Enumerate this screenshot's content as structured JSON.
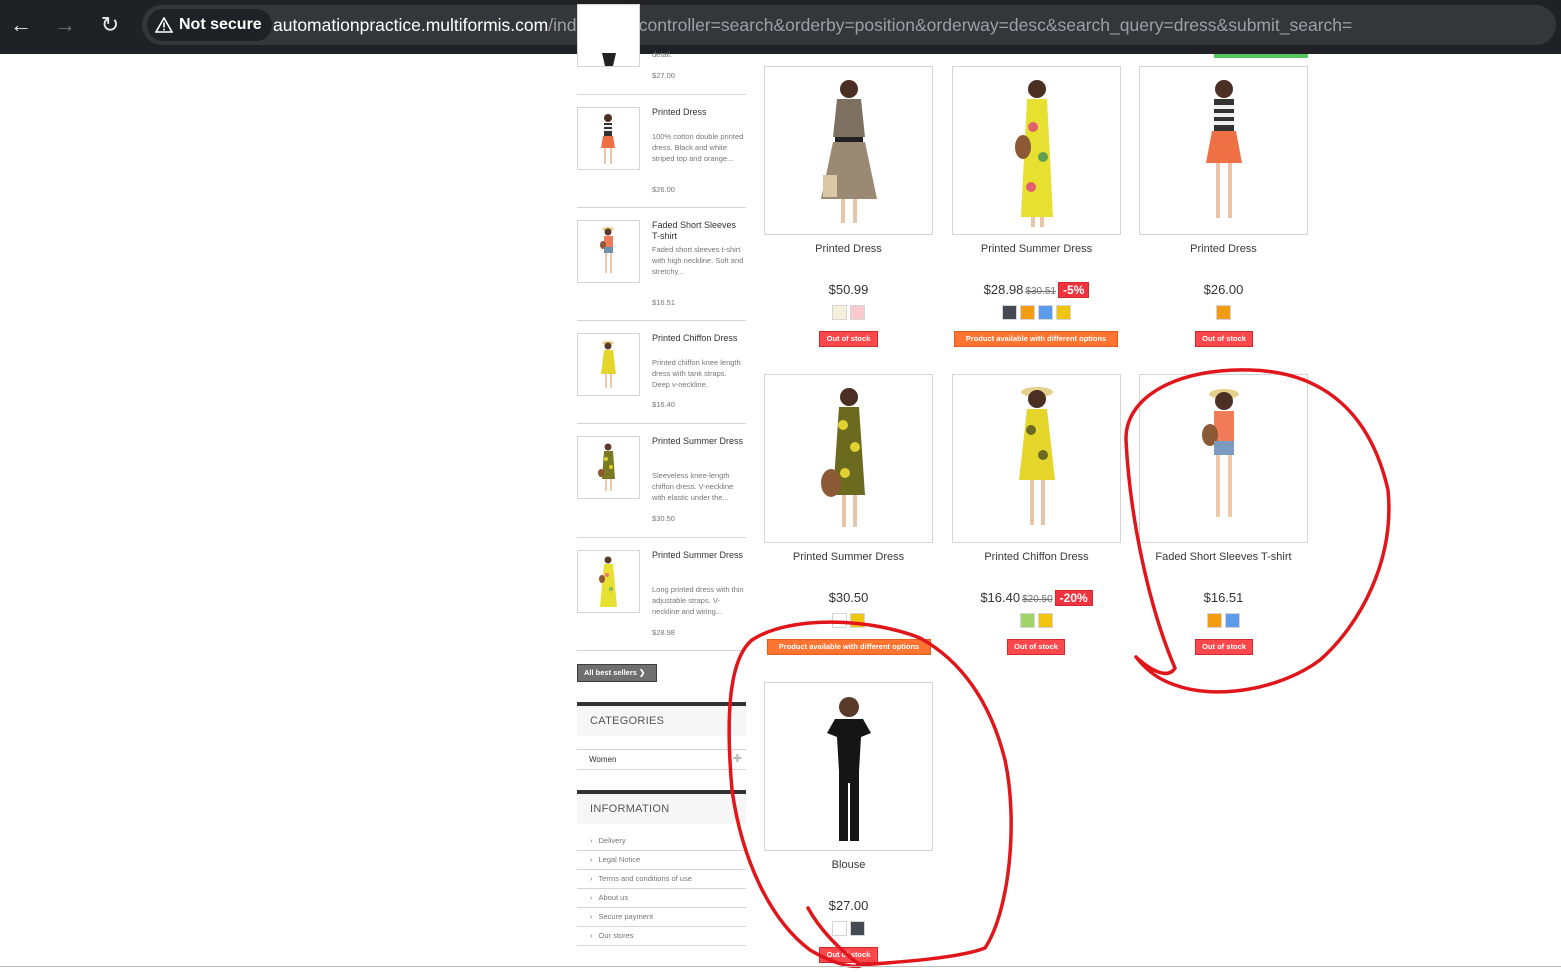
{
  "browser": {
    "security_label": "Not secure",
    "url_host": "automationpractice.multiformis.com",
    "url_path": "/index.php?controller=search&orderby=position&orderway=desc&search_query=dress&submit_search="
  },
  "sidebar": {
    "top_fragment": {
      "desc": "detail.",
      "price": "$27.00"
    },
    "best_sellers": [
      {
        "title": "Printed Dress",
        "desc": "100% cotton double printed dress. Black and white striped top and orange...",
        "price": "$26.00"
      },
      {
        "title": "Faded Short Sleeves T-shirt",
        "desc": "Faded short sleeves t-shirt with high neckline. Soft and stretchy...",
        "price": "$16.51"
      },
      {
        "title": "Printed Chiffon Dress",
        "desc": "Printed chiffon knee length dress with tank straps. Deep v-neckline.",
        "price": "$16.40"
      },
      {
        "title": "Printed Summer Dress",
        "desc": "Sleeveless knee-length chiffon dress. V-neckline with elastic under the...",
        "price": "$30.50"
      },
      {
        "title": "Printed Summer Dress",
        "desc": "Long printed dress with thin adjustable straps. V-neckline and wiring...",
        "price": "$28.98"
      }
    ],
    "all_best_sellers_label": "All best sellers",
    "categories_title": "CATEGORIES",
    "categories": [
      "Women"
    ],
    "information_title": "INFORMATION",
    "information_links": [
      "Delivery",
      "Legal Notice",
      "Terms and conditions of use",
      "About us",
      "Secure payment",
      "Our stores"
    ]
  },
  "products": [
    {
      "name": "Printed Dress",
      "price": "$50.99",
      "old_price": "",
      "discount": "",
      "swatches": [
        "#f5f0dc",
        "#fcc9ce"
      ],
      "availability": "Out of stock",
      "availability_type": "out"
    },
    {
      "name": "Printed Summer Dress",
      "price": "$28.98",
      "old_price": "$30.51",
      "discount": "-5%",
      "swatches": [
        "#434a54",
        "#f39c11",
        "#5d9cec",
        "#f1c40f"
      ],
      "availability": "Product available with different options",
      "availability_type": "opt"
    },
    {
      "name": "Printed Dress",
      "price": "$26.00",
      "old_price": "",
      "discount": "",
      "swatches": [
        "#f39c11"
      ],
      "availability": "Out of stock",
      "availability_type": "out"
    },
    {
      "name": "Printed Summer Dress",
      "price": "$30.50",
      "old_price": "",
      "discount": "",
      "swatches": [
        "#ffffff",
        "#f1c40f"
      ],
      "availability": "Product available with different options",
      "availability_type": "opt"
    },
    {
      "name": "Printed Chiffon Dress",
      "price": "$16.40",
      "old_price": "$20.50",
      "discount": "-20%",
      "swatches": [
        "#a0d468",
        "#f1c40f"
      ],
      "availability": "Out of stock",
      "availability_type": "out"
    },
    {
      "name": "Faded Short Sleeves T-shirt",
      "price": "$16.51",
      "old_price": "",
      "discount": "",
      "swatches": [
        "#f39c11",
        "#5d9cec"
      ],
      "availability": "Out of stock",
      "availability_type": "out"
    },
    {
      "name": "Blouse",
      "price": "$27.00",
      "old_price": "",
      "discount": "",
      "swatches": [
        "#ffffff",
        "#434a54"
      ],
      "availability": "Out of stock",
      "availability_type": "out"
    }
  ],
  "colors": {
    "annotation": "#e0161b",
    "out_of_stock": "#fe484c",
    "options": "#ff7430"
  }
}
